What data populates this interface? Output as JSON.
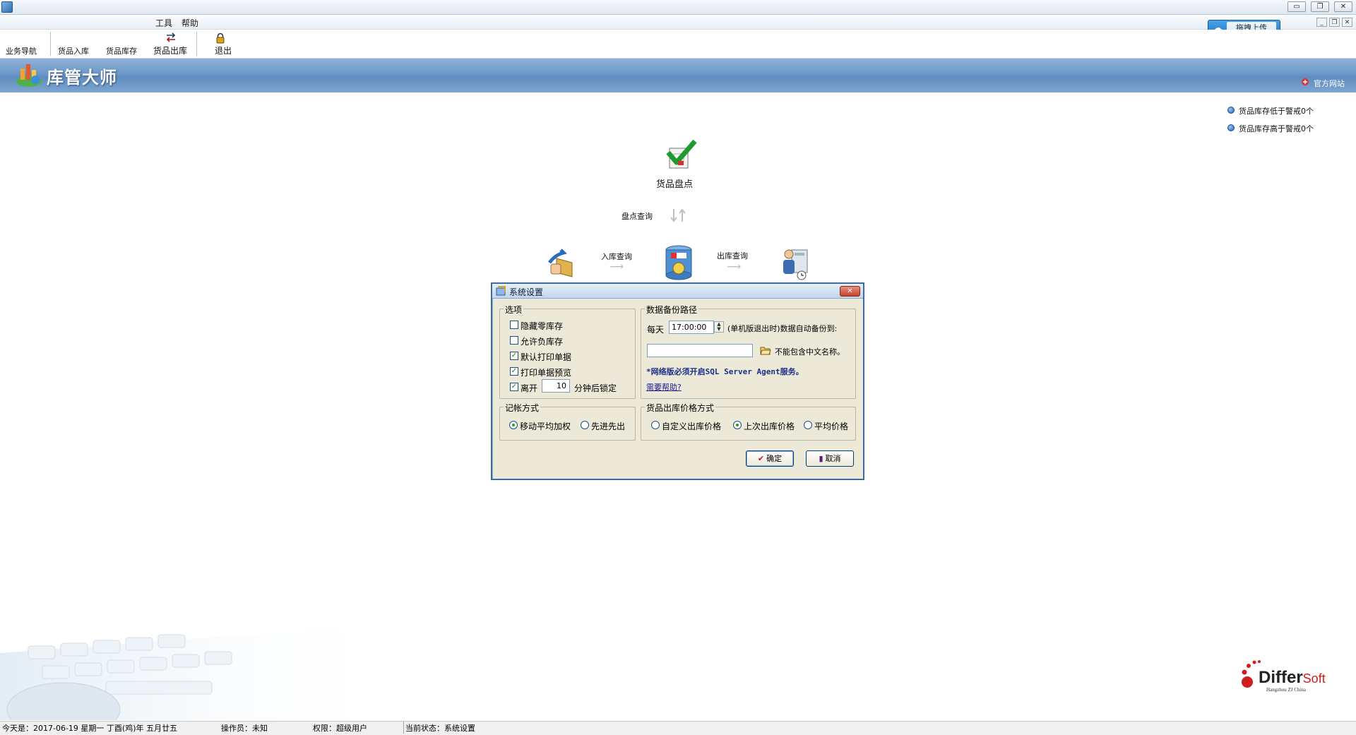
{
  "window": {
    "minimize_icon": "minimize-icon",
    "maximize_icon": "maximize-icon",
    "close_icon": "close-icon"
  },
  "menu": {
    "items": [
      "工具",
      "帮助"
    ]
  },
  "toolbar": {
    "items": [
      {
        "label": "业务导航"
      },
      {
        "label": "货品入库"
      },
      {
        "label": "货品库存"
      },
      {
        "label": "货品出库"
      },
      {
        "label": "退出"
      }
    ]
  },
  "upload": {
    "label": "拖拽上传",
    "icon": "cloud-icon"
  },
  "header": {
    "app_title": "库管大师",
    "website_link": "官方网站"
  },
  "alerts": [
    "货品库存低于警戒0个",
    "货品库存高于警戒0个"
  ],
  "flow": {
    "stocktake_label": "货品盘点",
    "stocktake_query": "盘点查询",
    "inbound_query": "入库查询",
    "outbound_query": "出库查询"
  },
  "dialog": {
    "title": "系统设置",
    "options_legend": "选项",
    "options": [
      {
        "label": "隐藏零库存",
        "checked": false
      },
      {
        "label": "允许负库存",
        "checked": false
      },
      {
        "label": "默认打印单据",
        "checked": true
      },
      {
        "label": "打印单据预览",
        "checked": true
      }
    ],
    "lock": {
      "label_before": "离开",
      "minutes": "10",
      "label_after": "分钟后锁定",
      "checked": true
    },
    "backup": {
      "legend": "数据备份路径",
      "daily_label": "每天",
      "time": "17:00:00",
      "auto_note": "(单机版退出时)数据自动备份到:",
      "path_value": "",
      "path_hint": "不能包含中文名称。",
      "sql_note": "*网络版必须开启SQL Server Agent服务。",
      "help_link": "需要帮助?"
    },
    "accounting": {
      "legend": "记帐方式",
      "options": [
        "移动平均加权",
        "先进先出"
      ],
      "selected": 0
    },
    "price": {
      "legend": "货品出库价格方式",
      "options": [
        "自定义出库价格",
        "上次出库价格",
        "平均价格"
      ],
      "selected": 1
    },
    "ok_label": "确定",
    "cancel_label": "取消"
  },
  "status": {
    "date": "今天是：2017-06-19 星期一 丁酉(鸡)年 五月廿五",
    "operator": "操作员：未知",
    "role": "权限：超级用户",
    "state": "当前状态：系统设置"
  },
  "brand": {
    "name_a": "Differ",
    "name_b": "Soft",
    "sub": "Hangzhou ZJ China"
  }
}
